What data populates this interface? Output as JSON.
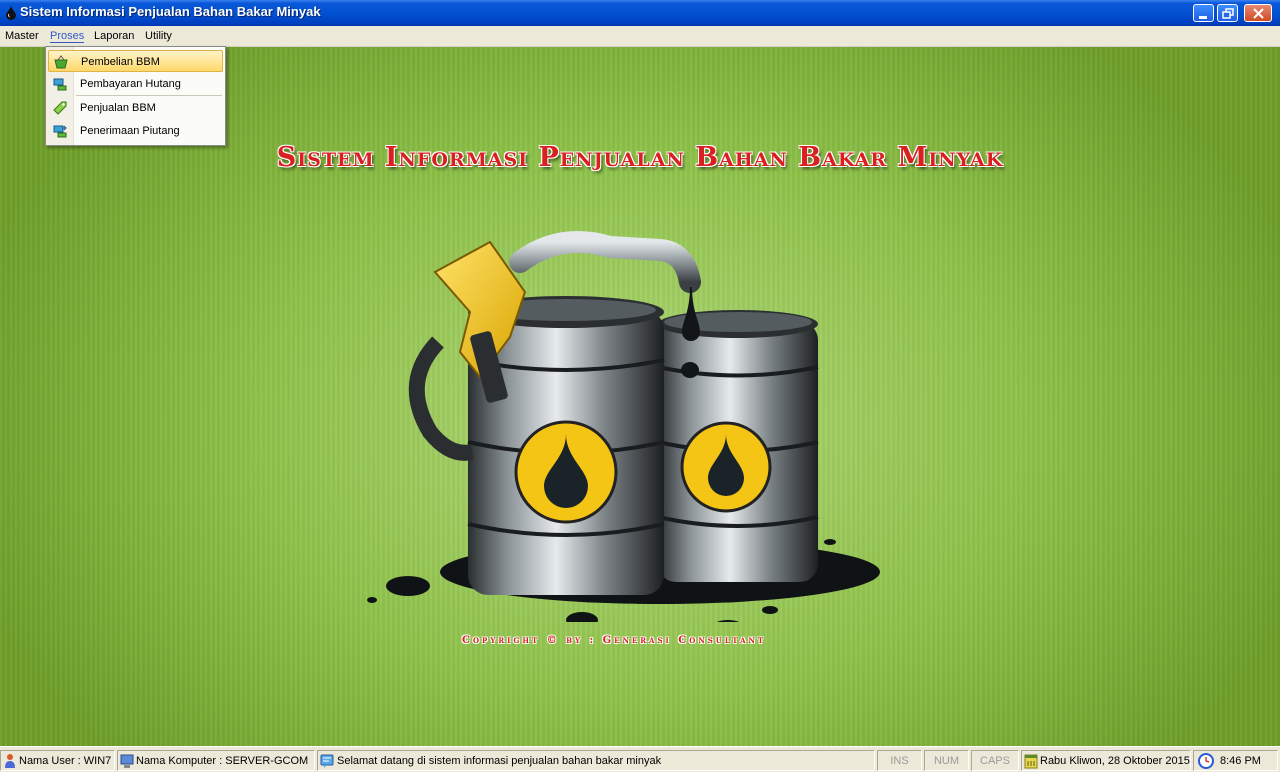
{
  "window": {
    "title": "Sistem Informasi Penjualan Bahan Bakar Minyak"
  },
  "menubar": {
    "items": [
      "Master",
      "Proses",
      "Laporan",
      "Utility"
    ],
    "active": "Proses"
  },
  "dropdown": {
    "items": [
      {
        "label": "Pembelian BBM",
        "icon": "basket-icon",
        "selected": true
      },
      {
        "label": "Pembayaran Hutang",
        "icon": "payment-icon",
        "selected": false
      },
      {
        "label": "Penjualan BBM",
        "icon": "tag-icon",
        "selected": false
      },
      {
        "label": "Penerimaan Piutang",
        "icon": "receive-icon",
        "selected": false
      }
    ]
  },
  "main": {
    "heading": "Sistem Informasi Penjualan Bahan Bakar Minyak",
    "copyright": "Copyright © by : Generasi Consultant",
    "accent_color": "#d91f1f",
    "background_color": "#8fc24a"
  },
  "statusbar": {
    "user": "Nama User : WIN7",
    "computer": "Nama Komputer : SERVER-GCOM",
    "message": "Selamat datang di sistem informasi penjualan bahan bakar minyak",
    "ins": "INS",
    "num": "NUM",
    "caps": "CAPS",
    "date": "Rabu Kliwon, 28 Oktober 2015",
    "time": "8:46 PM"
  }
}
